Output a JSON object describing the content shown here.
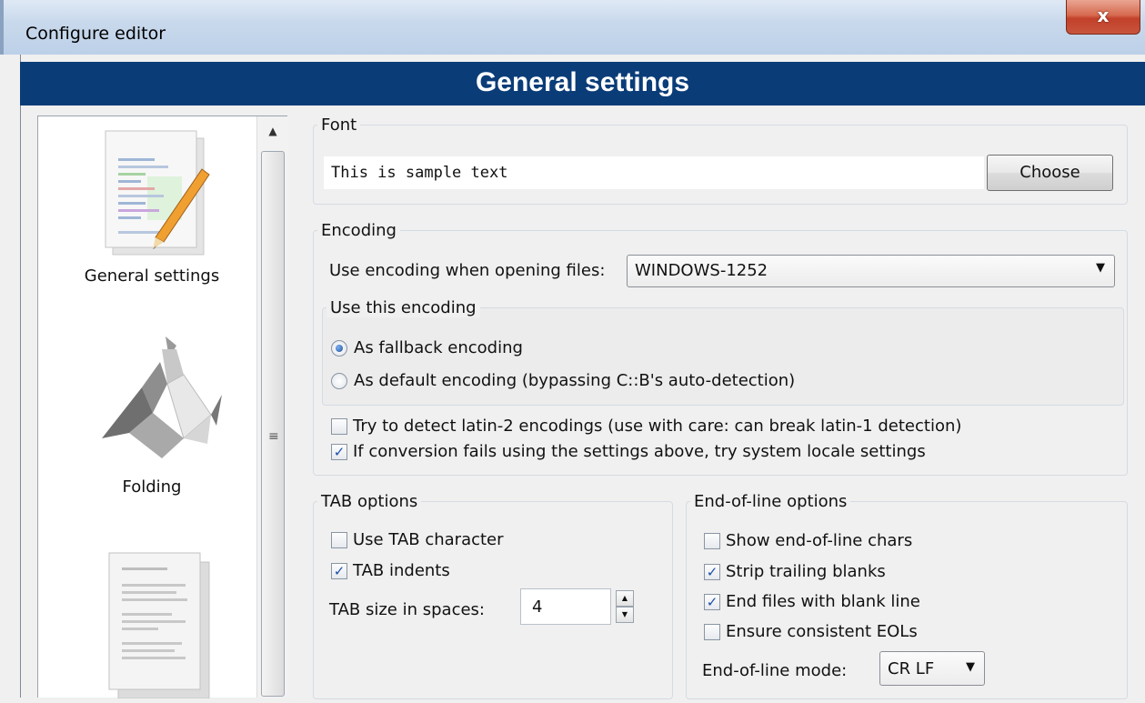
{
  "window": {
    "title": "Configure editor",
    "close_glyph": "x"
  },
  "header": {
    "title": "General settings"
  },
  "sidebar": {
    "items": [
      {
        "label": "General settings",
        "icon": "general-settings-icon"
      },
      {
        "label": "Folding",
        "icon": "folding-icon"
      },
      {
        "label": "",
        "icon": "document-icon"
      }
    ],
    "scroll_up": "▲",
    "grip": "≡"
  },
  "font": {
    "legend": "Font",
    "sample": "This is sample text",
    "choose_label": "Choose"
  },
  "encoding": {
    "legend": "Encoding",
    "open_label": "Use encoding when opening files:",
    "selected": "WINDOWS-1252",
    "use_this": {
      "legend": "Use this encoding",
      "options": [
        {
          "label": "As fallback encoding",
          "selected": true
        },
        {
          "label": "As default encoding (bypassing C::B's auto-detection)",
          "selected": false
        }
      ]
    },
    "latin2_label": "Try to detect latin-2 encodings (use with care: can break latin-1 detection)",
    "latin2_checked": false,
    "locale_label": "If conversion fails using the settings above, try system locale settings",
    "locale_checked": true
  },
  "tab": {
    "legend": "TAB options",
    "use_tab_label": "Use TAB character",
    "use_tab_checked": false,
    "indents_label": "TAB indents",
    "indents_checked": true,
    "size_label": "TAB size in spaces:",
    "size_value": "4"
  },
  "eol": {
    "legend": "End-of-line options",
    "items": [
      {
        "label": "Show end-of-line chars",
        "checked": false
      },
      {
        "label": "Strip trailing blanks",
        "checked": true
      },
      {
        "label": "End files with blank line",
        "checked": true
      },
      {
        "label": "Ensure consistent EOLs",
        "checked": false
      }
    ],
    "mode_label": "End-of-line mode:",
    "mode_value": "CR LF"
  },
  "glyphs": {
    "check": "✓",
    "dropdown": "▼",
    "spin_up": "▲",
    "spin_down": "▼"
  }
}
